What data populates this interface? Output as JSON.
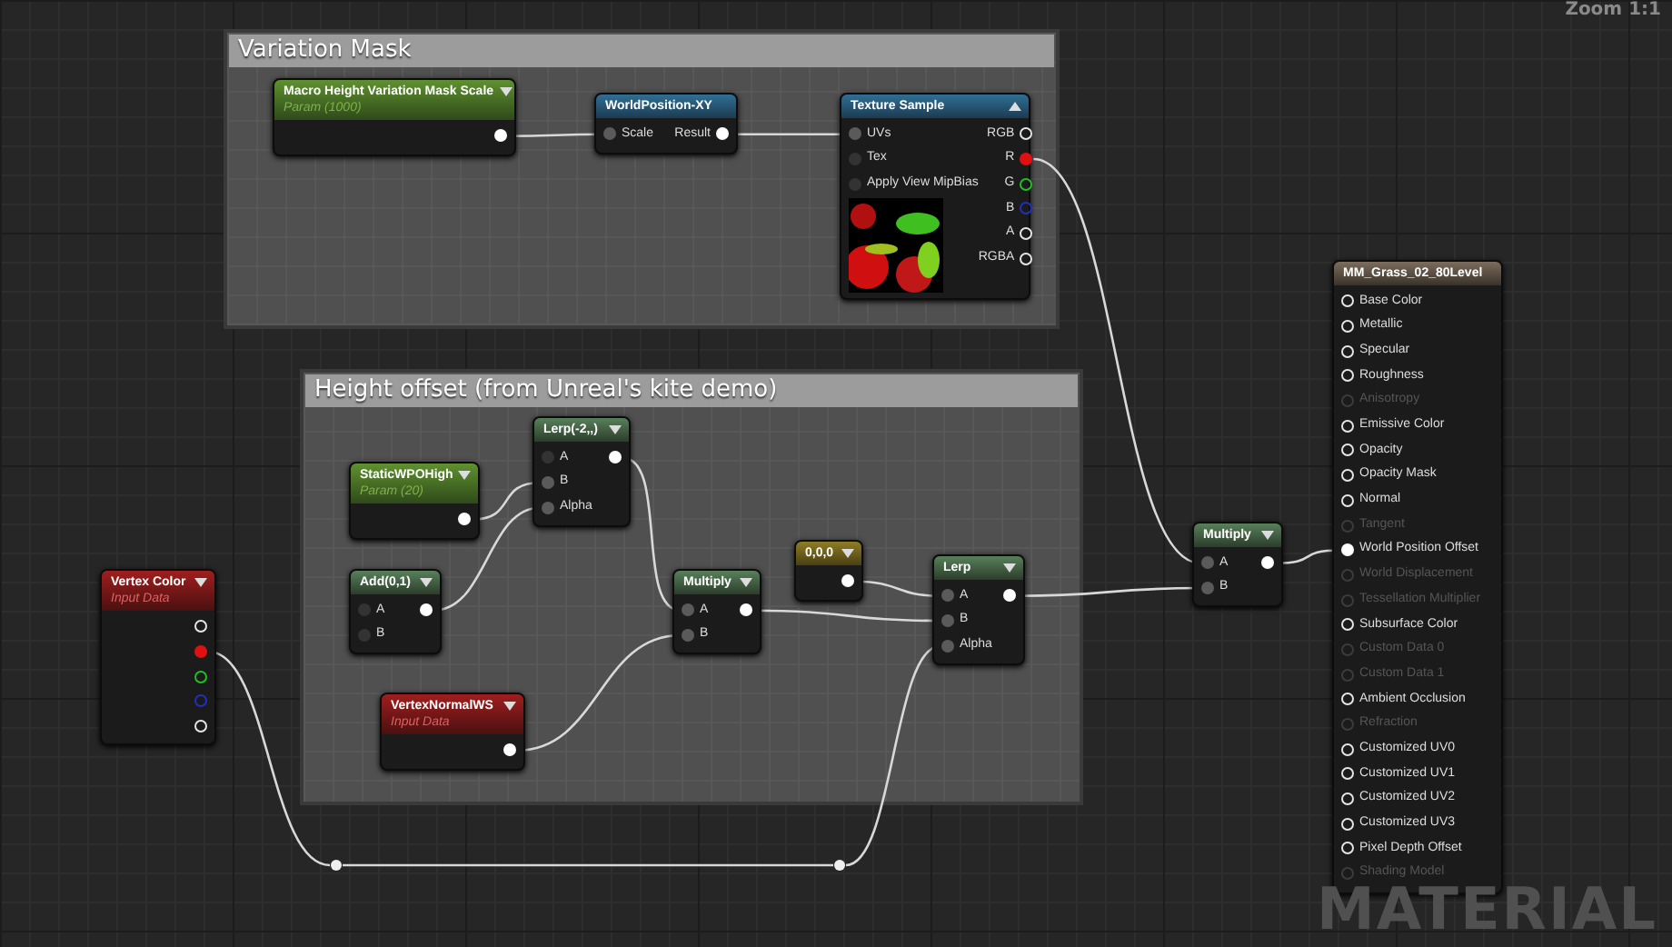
{
  "zoom_label": "Zoom 1:1",
  "graph_label": "MATERIAL",
  "comments": [
    {
      "title": "Variation Mask"
    },
    {
      "title": "Height offset (from Unreal's kite demo)"
    }
  ],
  "nodes": [
    {
      "kind": "param",
      "title": "Macro Height Variation Mask Scale",
      "subtitle": "Param (1000)",
      "advanced_expanded": false,
      "outputs": [
        {
          "connected": true
        }
      ]
    },
    {
      "kind": "function",
      "title": "WorldPosition-XY",
      "inputs": [
        {
          "label": "Scale",
          "connected": true
        }
      ],
      "outputs": [
        {
          "label": "Result",
          "connected": true
        }
      ]
    },
    {
      "kind": "function",
      "title": "Texture Sample",
      "advanced_expanded": true,
      "preview": true,
      "inputs": [
        {
          "label": "UVs",
          "connected": true
        },
        {
          "label": "Tex",
          "connected": false
        },
        {
          "label": "Apply View MipBias",
          "connected": false
        }
      ],
      "outputs": [
        {
          "label": "RGB",
          "connected": false
        },
        {
          "label": "R",
          "connected": true,
          "color": "#e01010"
        },
        {
          "label": "G",
          "connected": false,
          "color": "#20c020"
        },
        {
          "label": "B",
          "connected": false,
          "color": "#2030c0"
        },
        {
          "label": "A",
          "connected": false
        },
        {
          "label": "RGBA",
          "connected": false
        }
      ]
    },
    {
      "kind": "param",
      "title": "StaticWPOHigh",
      "subtitle": "Param (20)",
      "advanced_expanded": false,
      "outputs": [
        {
          "connected": true
        }
      ]
    },
    {
      "kind": "math",
      "title": "Lerp(-2,,)",
      "advanced_expanded": false,
      "inputs": [
        {
          "label": "A",
          "connected": false
        },
        {
          "label": "B",
          "connected": true
        },
        {
          "label": "Alpha",
          "connected": true
        }
      ],
      "outputs": [
        {
          "connected": true
        }
      ]
    },
    {
      "kind": "math",
      "title": "Add(0,1)",
      "advanced_expanded": false,
      "inputs": [
        {
          "label": "A",
          "connected": false
        },
        {
          "label": "B",
          "connected": false
        }
      ],
      "outputs": [
        {
          "connected": true
        }
      ]
    },
    {
      "kind": "math",
      "title": "Multiply",
      "advanced_expanded": false,
      "inputs": [
        {
          "label": "A",
          "connected": true
        },
        {
          "label": "B",
          "connected": true
        }
      ],
      "outputs": [
        {
          "connected": true
        }
      ]
    },
    {
      "kind": "constant",
      "title": "0,0,0",
      "advanced_expanded": false,
      "outputs": [
        {
          "connected": true
        }
      ]
    },
    {
      "kind": "math",
      "title": "Lerp",
      "advanced_expanded": false,
      "inputs": [
        {
          "label": "A",
          "connected": true
        },
        {
          "label": "B",
          "connected": true
        },
        {
          "label": "Alpha",
          "connected": true
        }
      ],
      "outputs": [
        {
          "connected": true
        }
      ]
    },
    {
      "kind": "input",
      "title": "VertexNormalWS",
      "subtitle": "Input Data",
      "advanced_expanded": false,
      "outputs": [
        {
          "connected": true
        }
      ]
    },
    {
      "kind": "input",
      "title": "Vertex Color",
      "subtitle": "Input Data",
      "advanced_expanded": false,
      "outputs": [
        {
          "connected": false
        },
        {
          "connected": true,
          "color": "#e01010"
        },
        {
          "connected": false,
          "color": "#20c020"
        },
        {
          "connected": false,
          "color": "#2030c0"
        },
        {
          "connected": false
        }
      ]
    },
    {
      "kind": "math",
      "title": "Multiply",
      "advanced_expanded": false,
      "inputs": [
        {
          "label": "A",
          "connected": true
        },
        {
          "label": "B",
          "connected": true
        }
      ],
      "outputs": [
        {
          "connected": true
        }
      ]
    },
    {
      "kind": "result",
      "title": "MM_Grass_02_80Level",
      "inputs": [
        {
          "label": "Base Color",
          "enabled": true,
          "connected": false
        },
        {
          "label": "Metallic",
          "enabled": true,
          "connected": false
        },
        {
          "label": "Specular",
          "enabled": true,
          "connected": false
        },
        {
          "label": "Roughness",
          "enabled": true,
          "connected": false
        },
        {
          "label": "Anisotropy",
          "enabled": false,
          "connected": false
        },
        {
          "label": "Emissive Color",
          "enabled": true,
          "connected": false
        },
        {
          "label": "Opacity",
          "enabled": true,
          "connected": false
        },
        {
          "label": "Opacity Mask",
          "enabled": true,
          "connected": false
        },
        {
          "label": "Normal",
          "enabled": true,
          "connected": false
        },
        {
          "label": "Tangent",
          "enabled": false,
          "connected": false
        },
        {
          "label": "World Position Offset",
          "enabled": true,
          "connected": true
        },
        {
          "label": "World Displacement",
          "enabled": false,
          "connected": false
        },
        {
          "label": "Tessellation Multiplier",
          "enabled": false,
          "connected": false
        },
        {
          "label": "Subsurface Color",
          "enabled": true,
          "connected": false
        },
        {
          "label": "Custom Data 0",
          "enabled": false,
          "connected": false
        },
        {
          "label": "Custom Data 1",
          "enabled": false,
          "connected": false
        },
        {
          "label": "Ambient Occlusion",
          "enabled": true,
          "connected": false
        },
        {
          "label": "Refraction",
          "enabled": false,
          "connected": false
        },
        {
          "label": "Customized UV0",
          "enabled": true,
          "connected": false
        },
        {
          "label": "Customized UV1",
          "enabled": true,
          "connected": false
        },
        {
          "label": "Customized UV2",
          "enabled": true,
          "connected": false
        },
        {
          "label": "Customized UV3",
          "enabled": true,
          "connected": false
        },
        {
          "label": "Pixel Depth Offset",
          "enabled": true,
          "connected": false
        },
        {
          "label": "Shading Model",
          "enabled": false,
          "connected": false
        }
      ]
    },
    {
      "kind": "knot"
    },
    {
      "kind": "knot"
    }
  ]
}
